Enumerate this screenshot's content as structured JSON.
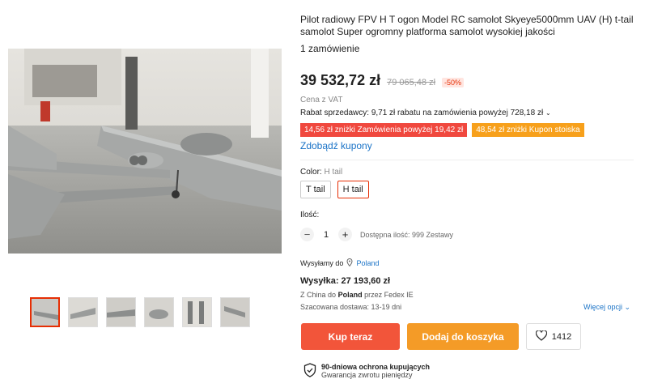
{
  "product": {
    "title": "Pilot radiowy FPV H T ogon Model RC samolot Skyeye5000mm UAV (H) t-tail samolot Super ogromny platforma samolot wysokiej jakości",
    "orders": "1 zamówienie",
    "price": "39 532,72 zł",
    "old_price": "79 065,48 zł",
    "discount": "-50%",
    "vat": "Cena z VAT",
    "rabat": "Rabat sprzedawcy: 9,71 zł rabatu na zamówienia powyżej 728,18 zł",
    "coupon_red": "14,56 zł zniżki Zamówienia powyżej 19,42 zł",
    "coupon_orange": "48,54 zł zniżki Kupon stoiska",
    "get_coupons": "Zdobądź kupony"
  },
  "color": {
    "label": "Color:",
    "value": "H tail",
    "options": [
      "T tail",
      "H tail"
    ]
  },
  "quantity": {
    "label": "Ilość:",
    "minus": "−",
    "value": "1",
    "plus": "+",
    "available": "Dostępna ilość: 999 Zestawy"
  },
  "shipping": {
    "ship_to_label": "Wysyłamy do",
    "country": "Poland",
    "cost": "Wysyłka: 27 193,60 zł",
    "from_prefix": "Z",
    "from_country": "China",
    "to_prefix": "do",
    "to_country": "Poland",
    "via": "przez Fedex IE",
    "delivery": "Szacowana dostawa: 13-19 dni",
    "more_options": "Więcej opcji"
  },
  "actions": {
    "buy_now": "Kup teraz",
    "add_to_cart": "Dodaj do koszyka",
    "wishlist_count": "1412"
  },
  "protection": {
    "title": "90-dniowa ochrona kupujących",
    "subtitle": "Gwarancja zwrotu pieniędzy"
  },
  "colors": {
    "accent_red": "#e62e04",
    "buy_button": "#f2553a",
    "cart_button": "#f49b27",
    "link_blue": "#1a73c7"
  }
}
